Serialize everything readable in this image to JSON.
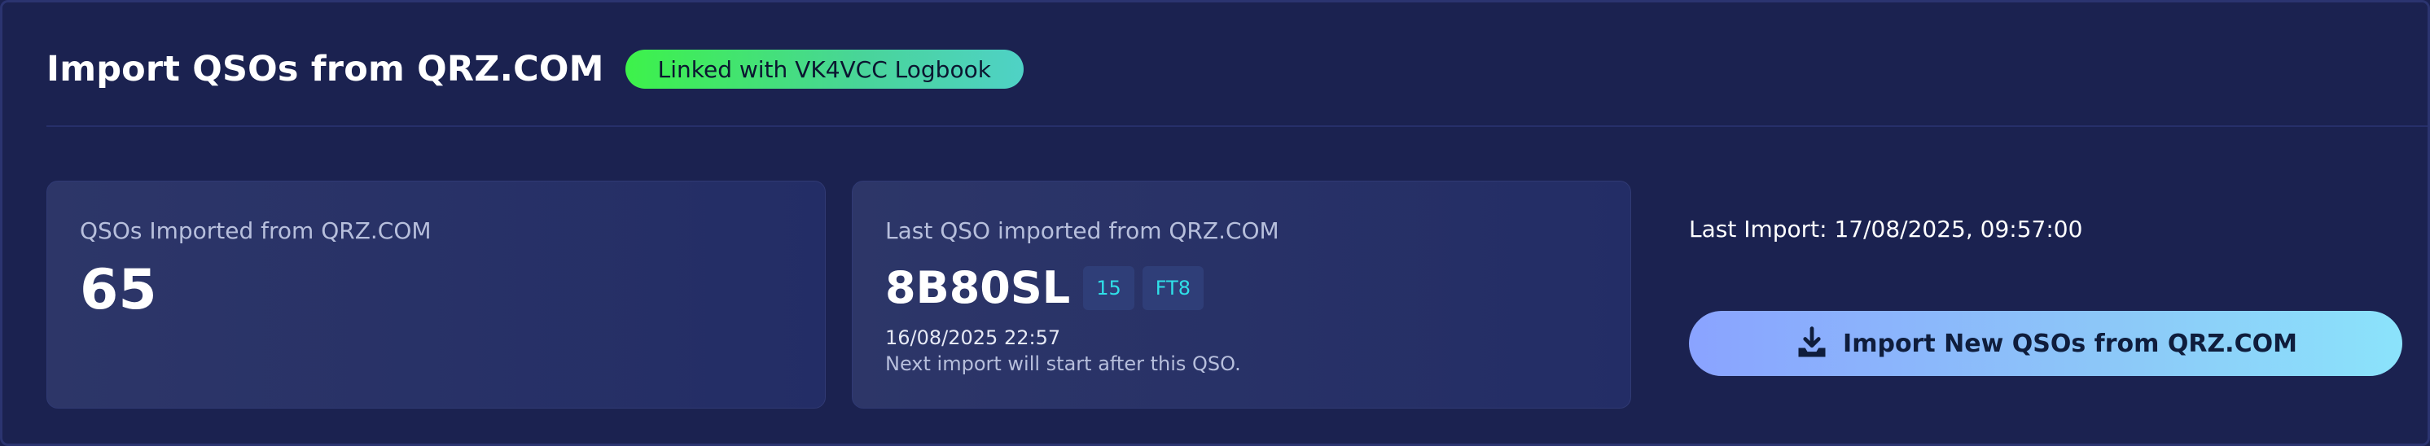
{
  "header": {
    "title": "Import QSOs from QRZ.COM",
    "linked_badge": "Linked with VK4VCC Logbook"
  },
  "stats": {
    "imported_label": "QSOs Imported from QRZ.COM",
    "imported_count": "65",
    "last_qso_label": "Last QSO imported from QRZ.COM",
    "last_qso": {
      "callsign": "8B80SL",
      "band": "15",
      "mode": "FT8",
      "datetime": "16/08/2025 22:57",
      "note": "Next import will start after this QSO."
    }
  },
  "import": {
    "last_import": "Last Import: 17/08/2025, 09:57:00",
    "button_label": "Import New QSOs from QRZ.COM",
    "button_icon": "download-icon"
  },
  "colors": {
    "background": "#1b2250",
    "card": "#2a3366",
    "badge_start": "#3df24a",
    "badge_end": "#4fd2c6",
    "tag_text": "#2fe0e8",
    "button_start": "#8aa3ff",
    "button_end": "#8be3fb"
  }
}
